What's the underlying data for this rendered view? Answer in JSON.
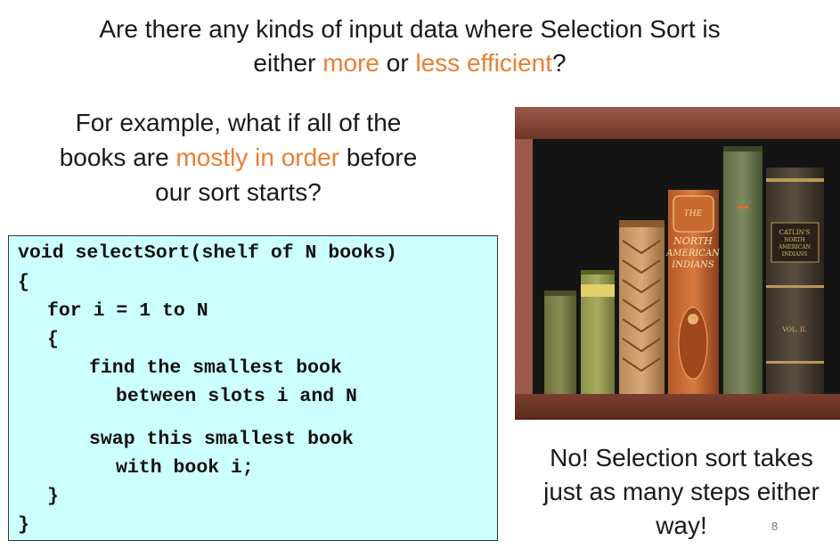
{
  "title": {
    "line1": "Are there any kinds of input data where Selection Sort is",
    "line2_pre": "either ",
    "line2_more": "more",
    "line2_or": " or ",
    "line2_less": "less efficient",
    "line2_end": "?"
  },
  "example": {
    "line1": "For example, what if all of the",
    "line2_pre": "books are ",
    "line2_accent": "mostly in order",
    "line2_post": " before",
    "line3": "our sort starts?"
  },
  "code": {
    "lines": [
      "void selectSort(shelf of N books)",
      "{",
      "for i = 1 to N",
      "{",
      "find the smallest book",
      "between slots i and N",
      "swap this smallest book",
      "with book i;",
      "}",
      "}"
    ]
  },
  "answer": {
    "line1": "No! Selection sort takes",
    "line2": "just as many steps either",
    "line3": "way!"
  },
  "page_number": "8",
  "books_photo": {
    "spine_text": {
      "book5_the": "THE",
      "book5_title1": "NORTH",
      "book5_title2": "AMERICAN",
      "book5_title3": "INDIANS",
      "book7_title1": "CATLIN'S",
      "book7_title2": "NORTH",
      "book7_title3": "AMERICAN",
      "book7_title4": "INDIANS",
      "book7_volume": "VOL. II."
    }
  },
  "colors": {
    "accent": "#ED7D31",
    "code_bg": "#CCFFFF",
    "text": "#1a1a1a",
    "shelf_wood": "#8B4A3A"
  }
}
